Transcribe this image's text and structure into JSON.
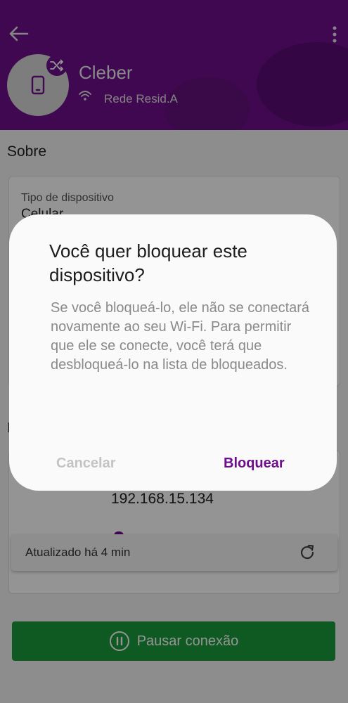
{
  "header": {
    "device_name": "Cleber",
    "network": "Rede Resid.A",
    "bg_color": "#6d0f8a",
    "back_icon": "arrow-left-icon",
    "menu_icon": "more-vert-icon",
    "avatar_icon": "smartphone-icon",
    "badge_icon": "shuffle-icon",
    "wifi_icon": "wifi-icon"
  },
  "about": {
    "title": "Sobre",
    "device_type_label": "Tipo de dispositivo",
    "device_type_value": "Celular"
  },
  "connection": {
    "ip": "192.168.15.134",
    "updated": "Atualizado há 4 min",
    "refresh_icon": "refresh-icon"
  },
  "pause_button": {
    "label": "Pausar conexão",
    "icon": "pause-circle-icon",
    "color": "#1a9a3b"
  },
  "dialog": {
    "title": "Você quer bloquear este dispositivo?",
    "body": "Se você bloqueá-lo, ele não se conectará novamente ao seu Wi-Fi. Para permitir que ele se conecte, você terá que desbloqueá-lo na lista de bloqueados.",
    "cancel_label": "Cancelar",
    "confirm_label": "Bloquear",
    "confirm_color": "#6d0f8a"
  }
}
